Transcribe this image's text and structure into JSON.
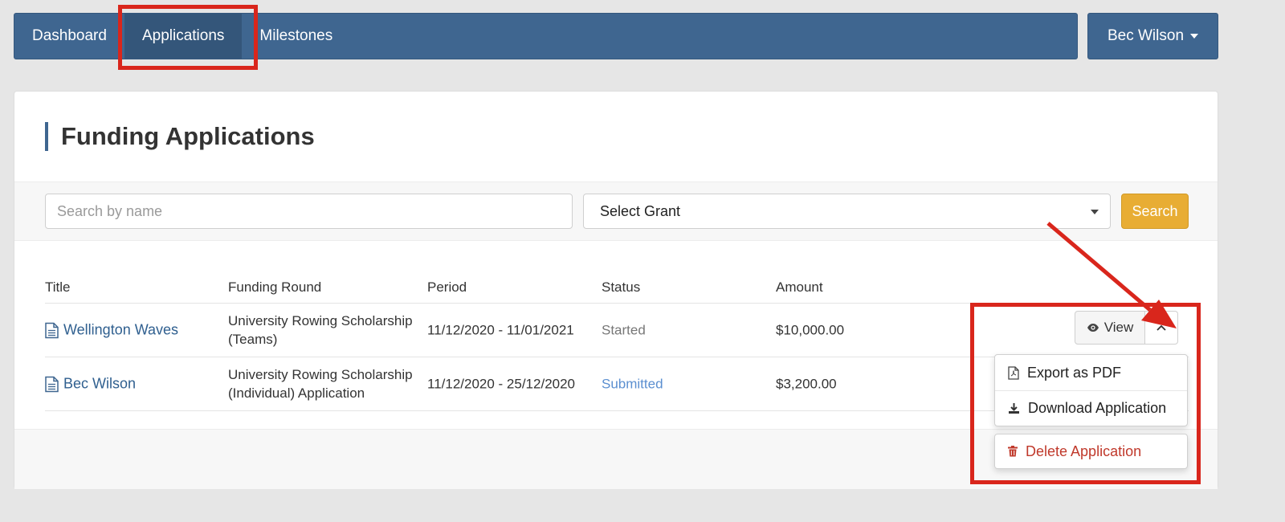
{
  "nav": {
    "items": [
      {
        "label": "Dashboard"
      },
      {
        "label": "Applications"
      },
      {
        "label": "Milestones"
      }
    ],
    "active_index": 1,
    "user_name": "Bec Wilson"
  },
  "page": {
    "title": "Funding Applications"
  },
  "filters": {
    "search_placeholder": "Search by name",
    "grant_select_value": "Select Grant",
    "search_button": "Search"
  },
  "table": {
    "headers": {
      "title": "Title",
      "round": "Funding Round",
      "period": "Period",
      "status": "Status",
      "amount": "Amount"
    },
    "rows": [
      {
        "title": "Wellington Waves",
        "round_line1": "University Rowing Scholarship",
        "round_line2": "(Teams)",
        "period": "11/12/2020 - 11/01/2021",
        "status": "Started",
        "amount": "$10,000.00"
      },
      {
        "title": "Bec Wilson",
        "round_line1": "University Rowing Scholarship",
        "round_line2": "(Individual) Application",
        "period": "11/12/2020 - 25/12/2020",
        "status": "Submitted",
        "amount": "$3,200.00"
      }
    ]
  },
  "actions": {
    "view_label": "View",
    "menu": {
      "export_pdf": "Export as PDF",
      "download": "Download Application",
      "delete": "Delete Application"
    }
  },
  "colors": {
    "nav_bg": "#3f6690",
    "nav_active": "#34567a",
    "accent_button": "#e8ad34",
    "link": "#2f5f8f",
    "status_submitted": "#5b8fd0",
    "danger": "#c0392b",
    "annotation": "#d9261c"
  },
  "icons": [
    "caret-down-icon",
    "document-icon",
    "eye-icon",
    "chevron-up-icon",
    "pdf-file-icon",
    "download-icon",
    "trash-icon"
  ]
}
